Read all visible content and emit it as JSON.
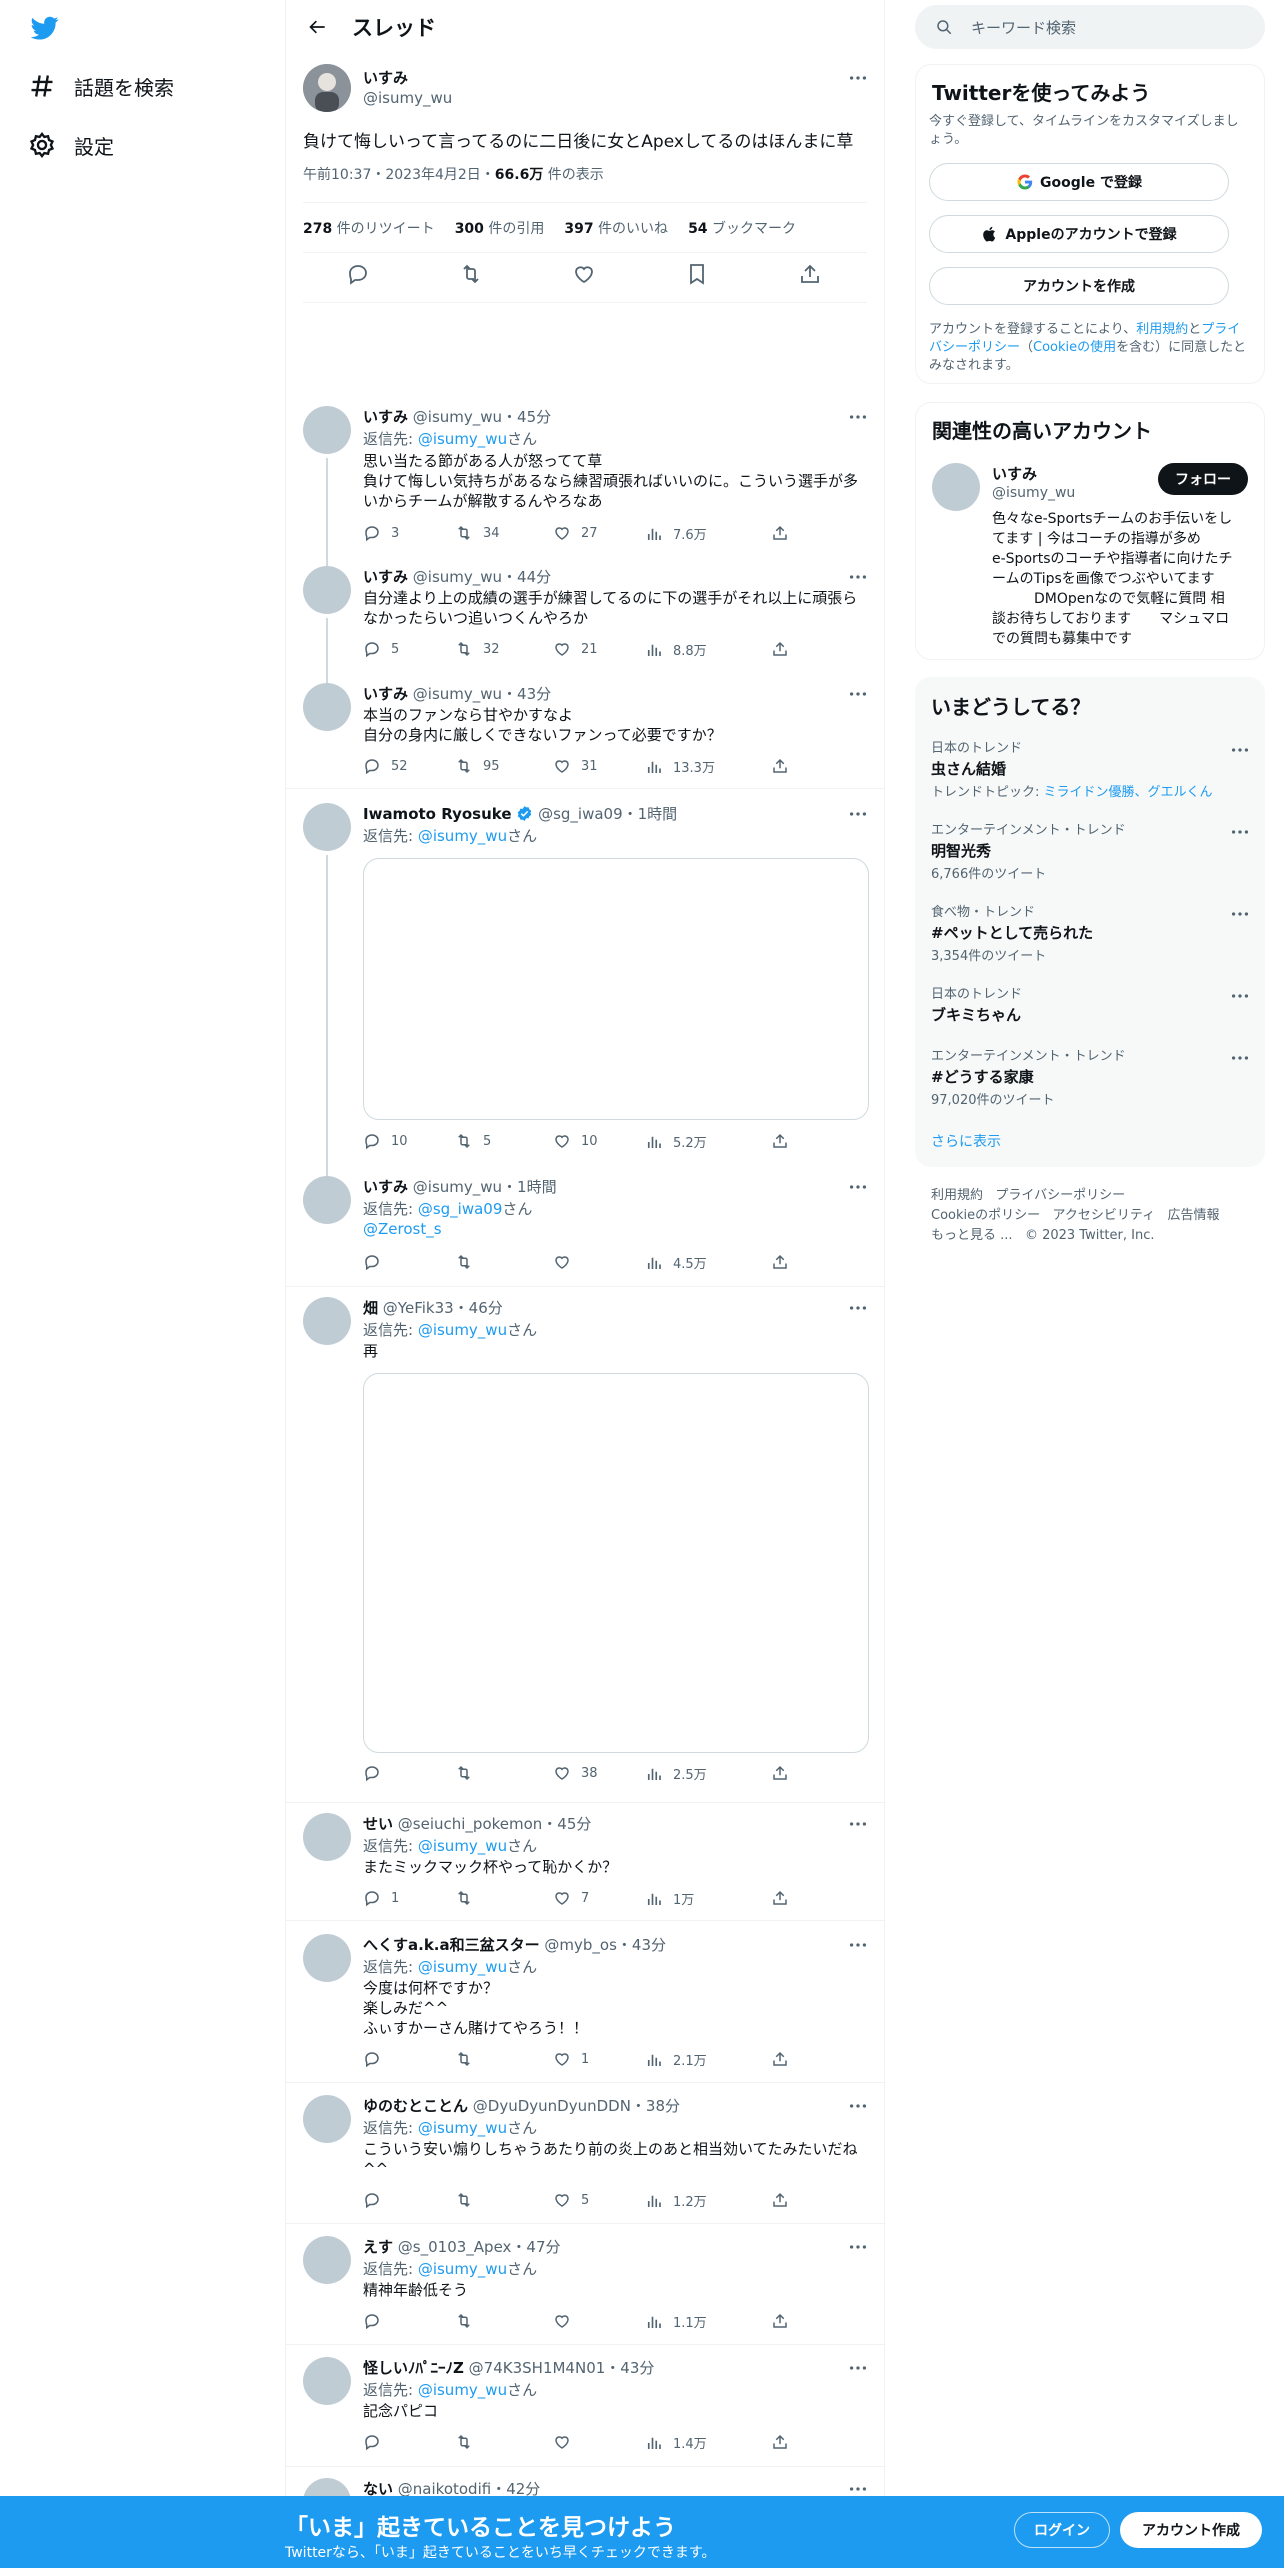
{
  "nav": {
    "items": [
      {
        "label": "話題を検索",
        "icon": "hashtag-icon"
      },
      {
        "label": "設定",
        "icon": "gear-icon"
      }
    ]
  },
  "header": {
    "title": "スレッド"
  },
  "main_tweet": {
    "name": "いすみ",
    "handle": "@isumy_wu",
    "text": "負けて悔しいって言ってるのに二日後に女とApexしてるのはほんまに草",
    "time": "午前10:37・2023年4月2日・",
    "views": "66.6万",
    "views_label": " 件の表示",
    "stats": [
      {
        "count": "278",
        "label": " 件のリツイート"
      },
      {
        "count": "300",
        "label": " 件の引用"
      },
      {
        "count": "397",
        "label": " 件のいいね"
      },
      {
        "count": "54",
        "label": " ブックマーク"
      }
    ]
  },
  "replies": [
    {
      "name": "いすみ",
      "handle": "@isumy_wu・45分",
      "reply_prefix": "返信先: ",
      "reply_to": "@isumy_wu",
      "reply_suffix": "さん",
      "lines": [
        "思い当たる節がある人が怒ってて草",
        "負けて悔しい気持ちがあるなら練習頑張ればいいのに。こういう選手が多",
        "いからチームが解散するんやろなあ"
      ],
      "comments": "3",
      "retweets": "34",
      "likes": "27",
      "views": "7.6万"
    },
    {
      "name": "いすみ",
      "handle": "@isumy_wu・44分",
      "lines": [
        "自分達より上の成績の選手が練習してるのに下の選手がそれ以上に頑張ら",
        "なかったらいつ追いつくんやろか"
      ],
      "comments": "5",
      "retweets": "32",
      "likes": "21",
      "views": "8.8万"
    },
    {
      "name": "いすみ",
      "handle": "@isumy_wu・43分",
      "lines": [
        "本当のファンなら甘やかすなよ",
        "自分の身内に厳しくできないファンって必要ですか？"
      ],
      "comments": "52",
      "retweets": "95",
      "likes": "31",
      "views": "13.3万"
    },
    {
      "name": "Iwamoto Ryosuke",
      "handle": "@sg_iwa09・1時間",
      "reply_prefix": "返信先: ",
      "reply_to": "@isumy_wu",
      "reply_suffix": "さん",
      "lines": [],
      "comments": "10",
      "retweets": "5",
      "likes": "10",
      "views": "5.2万"
    },
    {
      "name": "いすみ",
      "handle": "@isumy_wu・1時間",
      "reply_prefix": "返信先: ",
      "reply_to": "@sg_iwa09",
      "reply_suffix": "さん",
      "mention": "@Zerost_s",
      "lines": [],
      "comments": "",
      "retweets": "",
      "likes": "",
      "views": "4.5万"
    },
    {
      "name": "畑",
      "handle": "@YeFik33・46分",
      "reply_prefix": "返信先: ",
      "reply_to": "@isumy_wu",
      "reply_suffix": "さん",
      "lines": [
        "再"
      ],
      "comments": "",
      "retweets": "",
      "likes": "38",
      "views": "2.5万"
    },
    {
      "name": "せい",
      "handle": "@seiuchi_pokemon・45分",
      "reply_prefix": "返信先: ",
      "reply_to": "@isumy_wu",
      "reply_suffix": "さん",
      "lines": [
        "またミックマック杯やって恥かくか？"
      ],
      "comments": "1",
      "retweets": "",
      "likes": "7",
      "views": "1万"
    },
    {
      "name": "へくすa.k.a和三盆スター",
      "handle": "@myb_os・43分",
      "reply_prefix": "返信先: ",
      "reply_to": "@isumy_wu",
      "reply_suffix": "さん",
      "lines": [
        "今度は何杯ですか？",
        "楽しみだ^^",
        "ふぃすかーさん賭けてやろう！！"
      ],
      "comments": "",
      "retweets": "",
      "likes": "1",
      "views": "2.1万"
    },
    {
      "name": "ゆのむとことん",
      "handle": "@DyuDyunDyunDDN・38分",
      "reply_prefix": "返信先: ",
      "reply_to": "@isumy_wu",
      "reply_suffix": "さん",
      "lines": [
        "こういう安い煽りしちゃうあたり前の炎上のあと相当効いてたみたいだね",
        "^^"
      ],
      "comments": "",
      "retweets": "",
      "likes": "5",
      "views": "1.2万"
    },
    {
      "name": "えす",
      "handle": "@s_0103_Apex・47分",
      "reply_prefix": "返信先: ",
      "reply_to": "@isumy_wu",
      "reply_suffix": "さん",
      "lines": [
        "精神年齢低そう"
      ],
      "comments": "",
      "retweets": "",
      "likes": "",
      "views": "1.1万"
    },
    {
      "name": "怪しいﾉﾊﾟﾆｰﾉZ",
      "handle": "@74K3SH1M4N01・43分",
      "reply_prefix": "返信先: ",
      "reply_to": "@isumy_wu",
      "reply_suffix": "さん",
      "lines": [
        "記念パピコ"
      ],
      "comments": "",
      "retweets": "",
      "likes": "",
      "views": "1.4万"
    },
    {
      "name": "ない",
      "handle": "@naikotodifi・42分"
    }
  ],
  "search": {
    "placeholder": "キーワード検索"
  },
  "signup_card": {
    "title": "Twitterを使ってみよう",
    "subtitle": "今すぐ登録して、タイムラインをカスタマイズしましょう。",
    "google": "Google で登録",
    "apple": "Appleのアカウントで登録",
    "create": "アカウントを作成",
    "legal_1": "アカウントを登録することにより、",
    "legal_terms": "利用規約",
    "legal_2": "と",
    "legal_privacy": "プライバシーポリシー",
    "legal_3": "（",
    "legal_cookie": "Cookieの使用",
    "legal_4": "を含む）に同意したとみなされます。"
  },
  "related": {
    "title": "関連性の高いアカウント",
    "name": "いすみ",
    "handle": "@isumy_wu",
    "follow": "フォロー",
    "bio": [
      "色々なe-Sportsチームのお手伝いをし",
      "てます | 今はコーチの指導が多め",
      "e-Sportsのコーチや指導者に向けたチ",
      "ームのTipsを画像でつぶやいてます",
      "　　　DMOpenなので気軽に質問 相",
      "談お待ちしております　　マシュマロ",
      "での質問も募集中です"
    ]
  },
  "trends": {
    "title": "いまどうしてる？",
    "items": [
      {
        "meta": "日本のトレンド",
        "name": "虫さん結婚",
        "sub_prefix": "トレンドトピック: ",
        "sub_link": "ミライドン優勝、グエルくん"
      },
      {
        "meta": "エンターテインメント・トレンド",
        "name": "明智光秀",
        "sub": "6,766件のツイート"
      },
      {
        "meta": "食べ物・トレンド",
        "name": "#ペットとして売られた",
        "sub": "3,354件のツイート"
      },
      {
        "meta": "日本のトレンド",
        "name": "ブキミちゃん",
        "sub": ""
      },
      {
        "meta": "エンターテインメント・トレンド",
        "name": "#どうする家康",
        "sub": "97,020件のツイート"
      }
    ],
    "show_more": "さらに表示"
  },
  "footer": {
    "links": [
      "利用規約",
      "プライバシーポリシー",
      "Cookieのポリシー",
      "アクセシビリティ",
      "広告情報",
      "もっと見る ..."
    ],
    "copyright": "© 2023 Twitter, Inc."
  },
  "bottom_bar": {
    "title": "「いま」起きていることを見つけよう",
    "subtitle": "Twitterなら、「いま」起きていることをいち早くチェックできます。",
    "login": "ログイン",
    "signup": "アカウント作成"
  },
  "colors": {
    "accent": "#1d9bf0",
    "text": "#0f1419",
    "muted": "#536471",
    "border": "#eff3f4"
  }
}
